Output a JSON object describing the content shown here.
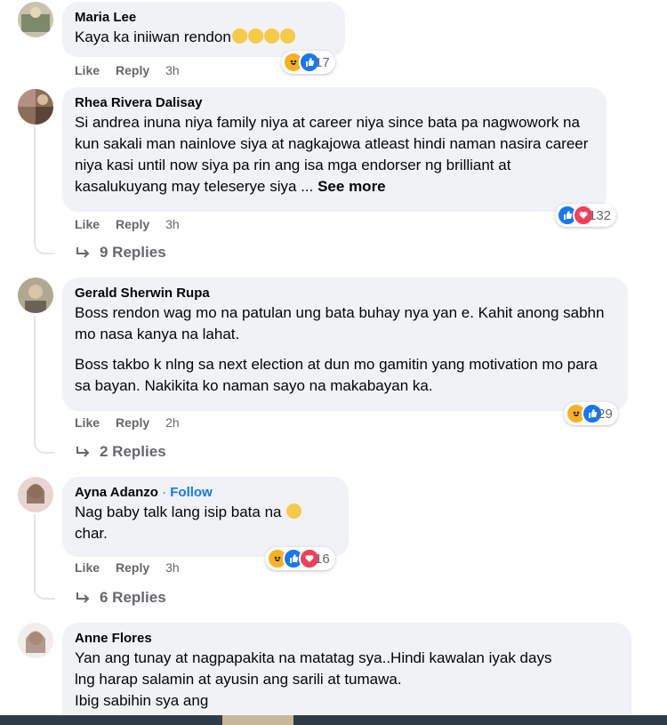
{
  "actions": {
    "like": "Like",
    "reply": "Reply"
  },
  "comments": [
    {
      "author": "Maria Lee",
      "text": [
        "Kaya ka iniiwan rendon"
      ],
      "time": "3h",
      "reaction_count": "17",
      "reactions": [
        "haha",
        "like"
      ]
    },
    {
      "author": "Rhea Rivera Dalisay",
      "text": [
        "Si andrea inuna niya family niya at career niya since bata pa nagwowork na kun sakali man nainlove siya at nagkajowa atleast hindi naman nasira career niya kasi until now siya pa rin ang isa mga endorser ng brilliant at kasalukuyang may teleserye siya ..."
      ],
      "see_more": "See more",
      "time": "3h",
      "reaction_count": "132",
      "reactions": [
        "like",
        "love"
      ],
      "replies": "9 Replies"
    },
    {
      "author": "Gerald Sherwin Rupa",
      "text": [
        "Boss rendon wag mo na patulan ung bata buhay nya yan e. Kahit anong sabhn mo nasa kanya na lahat.",
        "Boss takbo k nlng sa next election at dun mo gamitin yang motivation mo para sa bayan. Nakikita ko naman sayo na makabayan ka."
      ],
      "time": "2h",
      "reaction_count": "29",
      "reactions": [
        "haha",
        "like"
      ],
      "replies": "2 Replies"
    },
    {
      "author": "Ayna Adanzo",
      "follow": "Follow",
      "text": [
        "Nag baby talk lang isip bata na",
        "char."
      ],
      "time": "3h",
      "reaction_count": "16",
      "reactions": [
        "haha",
        "like",
        "love"
      ],
      "replies": "6 Replies"
    },
    {
      "author": "Anne Flores",
      "text": [
        "Yan ang tunay at nagpapakita na matatag sya..Hindi kawalan iyak days",
        "lng harap salamin at ayusin ang sarili at tumawa.",
        "Ibig sabihin sya ang"
      ]
    }
  ],
  "colors": {
    "link": "#1877f2",
    "bubble": "#f0f2f5",
    "meta": "#65676b",
    "haha": "#f7b125",
    "like": "#1877f2",
    "love": "#f33e58"
  }
}
